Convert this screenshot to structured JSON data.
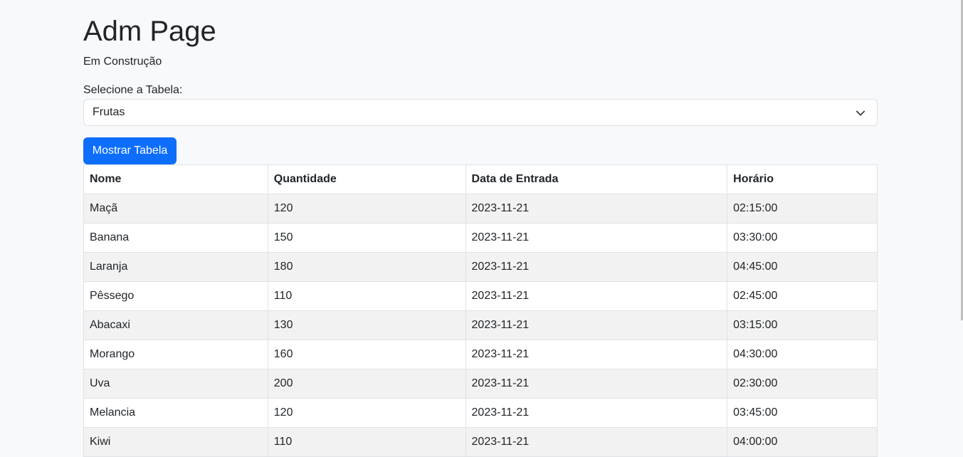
{
  "header": {
    "title": "Adm Page",
    "subtitle": "Em Construção"
  },
  "form": {
    "select_label": "Selecione a Tabela:",
    "selected_value": "Frutas",
    "button_label": "Mostrar Tabela"
  },
  "table": {
    "headers": [
      "Nome",
      "Quantidade",
      "Data de Entrada",
      "Horário"
    ],
    "rows": [
      [
        "Maçã",
        "120",
        "2023-11-21",
        "02:15:00"
      ],
      [
        "Banana",
        "150",
        "2023-11-21",
        "03:30:00"
      ],
      [
        "Laranja",
        "180",
        "2023-11-21",
        "04:45:00"
      ],
      [
        "Pêssego",
        "110",
        "2023-11-21",
        "02:45:00"
      ],
      [
        "Abacaxi",
        "130",
        "2023-11-21",
        "03:15:00"
      ],
      [
        "Morango",
        "160",
        "2023-11-21",
        "04:30:00"
      ],
      [
        "Uva",
        "200",
        "2023-11-21",
        "02:30:00"
      ],
      [
        "Melancia",
        "120",
        "2023-11-21",
        "03:45:00"
      ],
      [
        "Kiwi",
        "110",
        "2023-11-21",
        "04:00:00"
      ]
    ]
  },
  "colors": {
    "primary": "#0d6efd",
    "background": "#f8f9fa",
    "stripe": "#f2f2f2"
  }
}
